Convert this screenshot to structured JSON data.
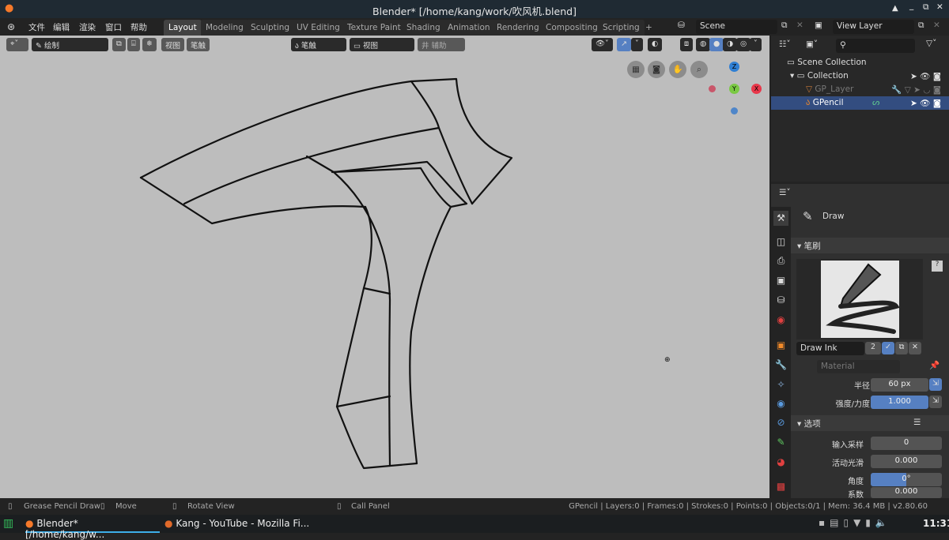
{
  "window": {
    "title": "Blender* [/home/kang/work/吹风机.blend]",
    "controls": [
      "▲",
      "_",
      "⧉",
      "✕"
    ]
  },
  "menu": [
    "文件",
    "编辑",
    "渲染",
    "窗口",
    "帮助"
  ],
  "workspaces": [
    "Layout",
    "Modeling",
    "Sculpting",
    "UV Editing",
    "Texture Paint",
    "Shading",
    "Animation",
    "Rendering",
    "Compositing",
    "Scripting",
    "+"
  ],
  "active_workspace": "Layout",
  "scene": {
    "name": "Scene",
    "view_layer": "View Layer"
  },
  "viewport_header": {
    "mode": "绘制",
    "view": "视图",
    "brush": "笔触",
    "stroke_placement": "笔触",
    "orientation": "视图",
    "guides": "辅助"
  },
  "gizmo": {
    "z": "Z",
    "y": "Y",
    "x": "X"
  },
  "outliner": {
    "items": [
      {
        "label": "Scene Collection"
      },
      {
        "label": "Collection"
      },
      {
        "label": "GP_Layer"
      },
      {
        "label": "GPencil",
        "selected": true
      }
    ]
  },
  "properties": {
    "tool": "Draw",
    "brush_section": "笔刷",
    "brush_name": "Draw Ink",
    "brush_users": "2",
    "material_placeholder": "Material",
    "radius_label": "半径",
    "radius": "60 px",
    "strength_label": "强度/力度",
    "strength": "1.000",
    "strength_fill": 1.0,
    "options_section": "选项",
    "input_samples_label": "输入采样",
    "input_samples": "0",
    "active_smooth_label": "活动光滑",
    "active_smooth": "0.000",
    "angle_label": "角度",
    "angle": "0°",
    "angle_fill": 0.5,
    "factor_label": "系数",
    "factor": "0.000"
  },
  "status": {
    "left": "Grease Pencil Draw",
    "move": "Move",
    "rotate": "Rotate View",
    "call": "Call Panel",
    "right": "GPencil | Layers:0 | Frames:0 | Strokes:0 | Points:0 | Objects:0/1 | Mem: 36.4 MB | v2.80.60"
  },
  "taskbar": {
    "tasks": [
      "Blender* [/home/kang/w...",
      "Kang - YouTube - Mozilla Fi..."
    ],
    "clock": "11:31"
  },
  "colors": {
    "accent": "#5680c2",
    "selected_row": "#334d80",
    "viewport": "#bdbdbd"
  }
}
